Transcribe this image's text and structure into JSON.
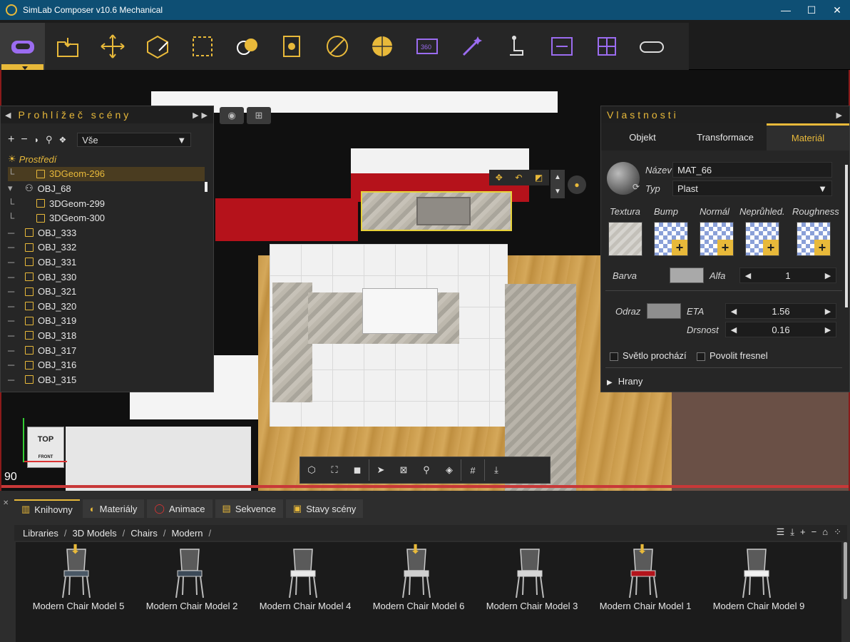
{
  "window": {
    "title": "SimLab Composer v10.6 Mechanical",
    "controls": [
      "—",
      "☐",
      "✕"
    ]
  },
  "toolbar": {
    "tools": [
      {
        "name": "vr-mode-tool",
        "icon": "vr-headset-icon",
        "active": true
      },
      {
        "name": "import-tool",
        "icon": "import-folder-icon"
      },
      {
        "name": "move-tool",
        "icon": "move-arrows-icon"
      },
      {
        "name": "edit-geometry-tool",
        "icon": "box-edit-icon"
      },
      {
        "name": "selection-box-tool",
        "icon": "selection-box-icon"
      },
      {
        "name": "materials-tool",
        "icon": "material-balls-icon"
      },
      {
        "name": "texture-tool",
        "icon": "texture-icon"
      },
      {
        "name": "clipping-tool",
        "icon": "circle-slash-icon"
      },
      {
        "name": "environment-tool",
        "icon": "globe-icon"
      },
      {
        "name": "panorama-360-tool",
        "icon": "panorama-360-icon"
      },
      {
        "name": "effects-tool",
        "icon": "magic-wand-icon"
      },
      {
        "name": "interactions-tool",
        "icon": "touch-icon"
      },
      {
        "name": "sequence-tool",
        "icon": "sequence-icon"
      },
      {
        "name": "layout-tool",
        "icon": "grid-layout-icon"
      },
      {
        "name": "vr-viewer-tool",
        "icon": "vr-goggles-icon"
      }
    ]
  },
  "viewport": {
    "zoom_readout": "90",
    "orientation_label": "TOP",
    "orientation_sub": "FRONT"
  },
  "scene_browser": {
    "title": "Prohlížeč scény",
    "filter": "Vše",
    "tree": [
      {
        "label": "Prostředí",
        "level": 0,
        "kind": "environment"
      },
      {
        "label": "3DGeom-296",
        "level": 2,
        "kind": "geom",
        "selected": true
      },
      {
        "label": "OBJ_68",
        "level": 1,
        "kind": "group"
      },
      {
        "label": "3DGeom-299",
        "level": 2,
        "kind": "geom"
      },
      {
        "label": "3DGeom-300",
        "level": 2,
        "kind": "geom"
      },
      {
        "label": "OBJ_333",
        "level": 1,
        "kind": "obj"
      },
      {
        "label": "OBJ_332",
        "level": 1,
        "kind": "obj"
      },
      {
        "label": "OBJ_331",
        "level": 1,
        "kind": "obj"
      },
      {
        "label": "OBJ_330",
        "level": 1,
        "kind": "obj"
      },
      {
        "label": "OBJ_321",
        "level": 1,
        "kind": "obj"
      },
      {
        "label": "OBJ_320",
        "level": 1,
        "kind": "obj"
      },
      {
        "label": "OBJ_319",
        "level": 1,
        "kind": "obj"
      },
      {
        "label": "OBJ_318",
        "level": 1,
        "kind": "obj"
      },
      {
        "label": "OBJ_317",
        "level": 1,
        "kind": "obj"
      },
      {
        "label": "OBJ_316",
        "level": 1,
        "kind": "obj"
      },
      {
        "label": "OBJ_315",
        "level": 1,
        "kind": "obj"
      }
    ]
  },
  "properties": {
    "title": "Vlastnosti",
    "tabs": [
      "Objekt",
      "Transformace",
      "Materiál"
    ],
    "active_tab": "Materiál",
    "name_label": "Název",
    "name_value": "MAT_66",
    "type_label": "Typ",
    "type_value": "Plast",
    "texture_labels": [
      "Textura",
      "Bump",
      "Normál",
      "Neprůhled.",
      "Roughness"
    ],
    "color_label": "Barva",
    "alpha_label": "Alfa",
    "alpha_value": "1",
    "reflection_label": "Odraz",
    "eta_label": "ETA",
    "eta_value": "1.56",
    "roughness_label": "Drsnost",
    "roughness_value": "0.16",
    "light_through_label": "Světlo prochází",
    "fresnel_label": "Povolit fresnel",
    "edges_label": "Hrany",
    "colors": {
      "base": "#a9a9a9",
      "reflection": "#8e8e8e"
    }
  },
  "library": {
    "tabs": [
      "Knihovny",
      "Materiály",
      "Animace",
      "Sekvence",
      "Stavy scény"
    ],
    "active_tab": "Knihovny",
    "breadcrumb": [
      "Libraries",
      "3D Models",
      "Chairs",
      "Modern"
    ],
    "items": [
      {
        "name": "Modern Chair Model 5",
        "download": true,
        "seat": "#4a5866"
      },
      {
        "name": "Modern Chair Model 2",
        "download": false,
        "seat": "#3c4a58"
      },
      {
        "name": "Modern Chair Model 4",
        "download": false,
        "seat": "#e8e8e8"
      },
      {
        "name": "Modern Chair Model 6",
        "download": true,
        "seat": "#cfcfcf"
      },
      {
        "name": "Modern Chair Model 3",
        "download": false,
        "seat": "#d6d6d6"
      },
      {
        "name": "Modern Chair Model 1",
        "download": true,
        "seat": "#b3141c"
      },
      {
        "name": "Modern Chair Model 9",
        "download": false,
        "seat": "#f0f0f0"
      }
    ]
  },
  "colors": {
    "accent": "#e8b93a",
    "titlebar": "#0e4f74",
    "accent_purple": "#9b6cf0"
  }
}
